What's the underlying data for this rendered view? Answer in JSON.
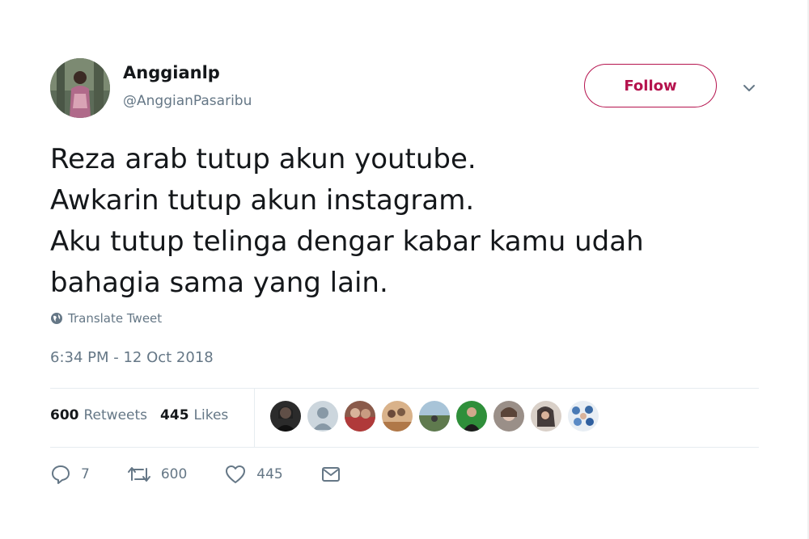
{
  "user": {
    "name": "Anggianlp",
    "handle": "@AnggianPasaribu"
  },
  "follow_label": "Follow",
  "tweet": {
    "lines": [
      "Reza arab tutup akun youtube.",
      "Awkarin tutup akun instagram.",
      "Aku tutup telinga dengar kabar kamu udah",
      "bahagia sama yang lain."
    ]
  },
  "translate_label": "Translate Tweet",
  "timestamp": "6:34 PM - 12 Oct 2018",
  "stats": {
    "retweets_count": "600",
    "retweets_label": "Retweets",
    "likes_count": "445",
    "likes_label": "Likes"
  },
  "liker_avatars": [
    "avatar",
    "default-avatar",
    "avatar",
    "avatar",
    "avatar",
    "avatar",
    "avatar",
    "avatar",
    "avatar"
  ],
  "actions": {
    "reply_count": "7",
    "retweet_count": "600",
    "like_count": "445"
  },
  "colors": {
    "accent": "#b5134e",
    "secondary_text": "#657786",
    "primary_text": "#14171a"
  },
  "icons": [
    "caret-down-icon",
    "globe-icon",
    "reply-icon",
    "retweet-icon",
    "heart-icon",
    "message-icon"
  ]
}
